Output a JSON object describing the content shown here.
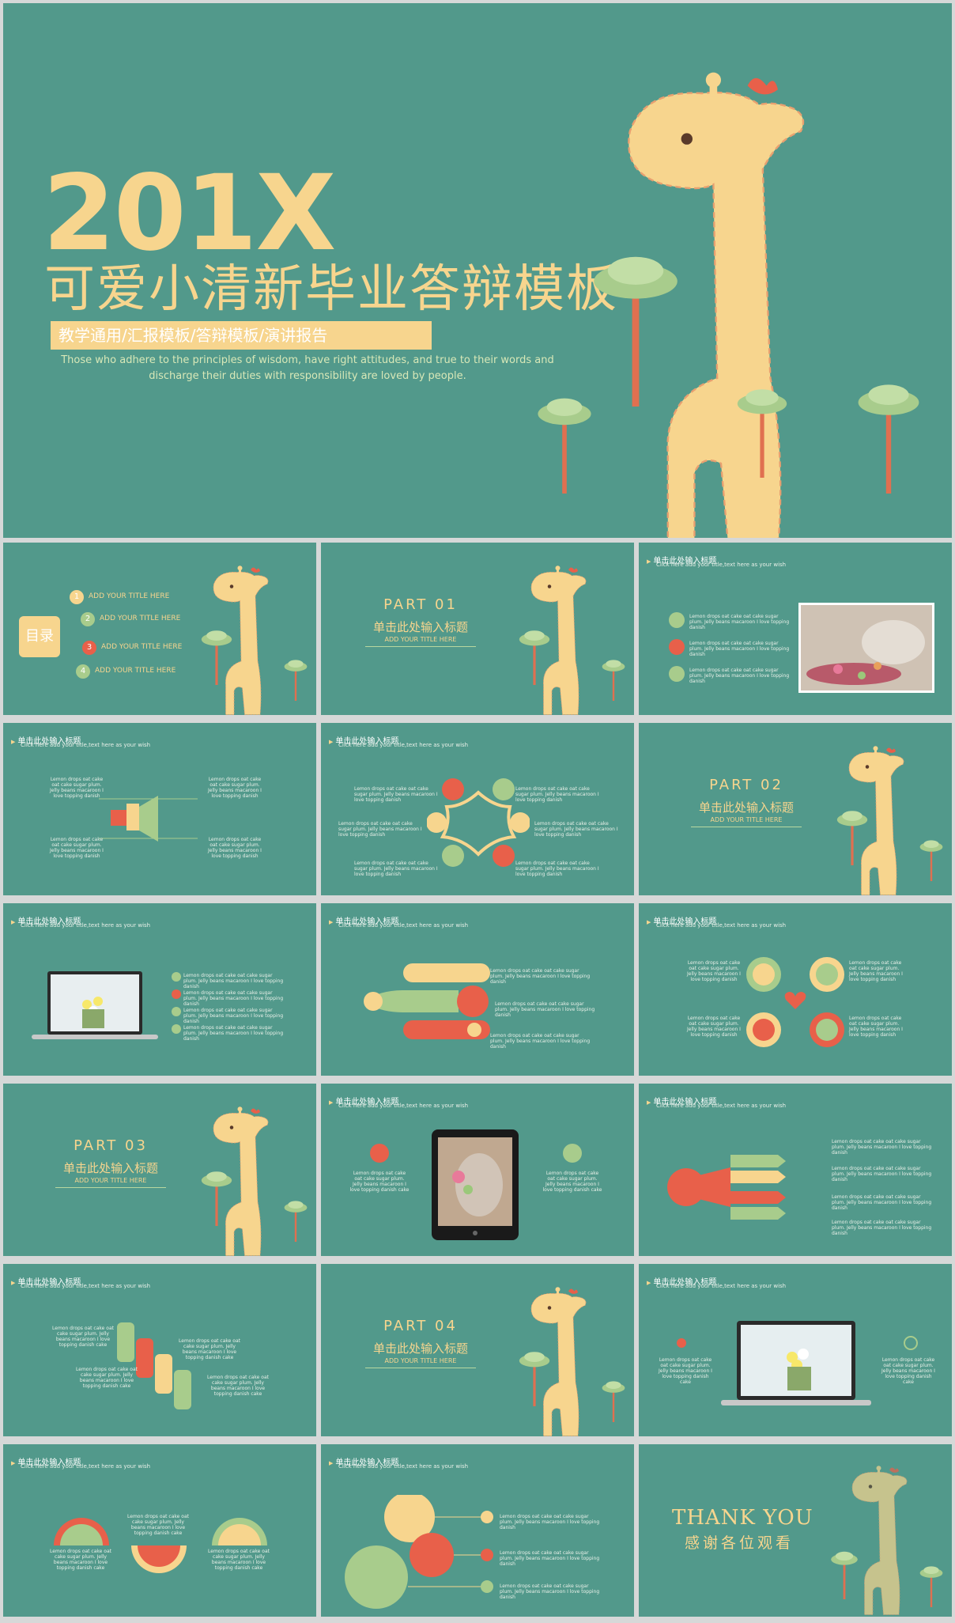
{
  "hero": {
    "year": "201X",
    "title": "可爱小清新毕业答辩模板",
    "tagline": "教学通用/汇报模板/答辩模板/演讲报告",
    "description": "Those who adhere to the principles of wisdom, have right attitudes, and true to their words and discharge their duties with responsibility are loved by people."
  },
  "toc": {
    "label": "目录",
    "items": [
      {
        "num": "1",
        "text": "ADD YOUR TITLE HERE"
      },
      {
        "num": "2",
        "text": "ADD YOUR TITLE HERE"
      },
      {
        "num": "3",
        "text": "ADD YOUR TITLE HERE"
      },
      {
        "num": "4",
        "text": "ADD YOUR TITLE HERE"
      }
    ]
  },
  "slide_header": {
    "title": "单击此处输入标题",
    "subtitle": "Click here add your title,text here as your wish"
  },
  "parts": [
    {
      "label": "PART 01",
      "title": "单击此处输入标题",
      "sub": "ADD YOUR TITLE HERE"
    },
    {
      "label": "PART 02",
      "title": "单击此处输入标题",
      "sub": "ADD YOUR TITLE HERE"
    },
    {
      "label": "PART 03",
      "title": "单击此处输入标题",
      "sub": "ADD YOUR TITLE HERE"
    },
    {
      "label": "PART 04",
      "title": "单击此处输入标题",
      "sub": "ADD YOUR TITLE HERE"
    }
  ],
  "lorem_short": "Lemon drops oat cake oat cake sugar plum. Jelly beans macaroon I love topping danish",
  "lorem_cake": "Lemon drops oat cake oat cake sugar plum. Jelly beans macaroon I love topping danish cake",
  "thanks": {
    "en": "THANK YOU",
    "cn": "感谢各位观看"
  },
  "colors": {
    "bg": "#52998b",
    "yellow": "#f7d58e",
    "red": "#e8604a",
    "green": "#a8cc8c",
    "trunk": "#e07050"
  }
}
